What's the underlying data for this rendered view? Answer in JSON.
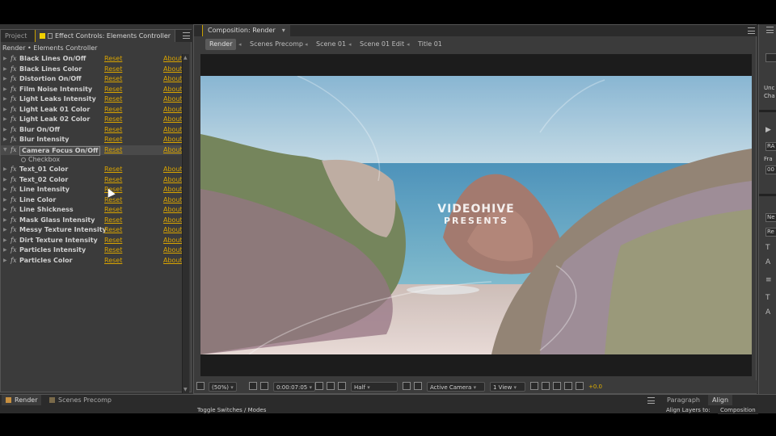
{
  "left_panel": {
    "tab_project": "Project",
    "tab_effect_controls": "Effect Controls: Elements Controller",
    "breadcrumb": "Render • Elements Controller",
    "reset_label": "Reset",
    "about_label": "About",
    "fx_label": "fx",
    "effects": [
      {
        "name": "Black Lines On/Off"
      },
      {
        "name": "Black Lines Color"
      },
      {
        "name": "Distortion On/Off"
      },
      {
        "name": "Film Noise Intensity"
      },
      {
        "name": "Light Leaks Intensity"
      },
      {
        "name": "Light Leak 01 Color"
      },
      {
        "name": "Light Leak 02 Color"
      },
      {
        "name": "Blur On/Off"
      },
      {
        "name": "Blur Intensity"
      },
      {
        "name": "Camera Focus On/Off",
        "expanded": true,
        "selected": true,
        "sub_label": "Checkbox"
      },
      {
        "name": "Text_01 Color"
      },
      {
        "name": "Text_02 Color"
      },
      {
        "name": "Line Intensity"
      },
      {
        "name": "Line Color"
      },
      {
        "name": "Line Shickness"
      },
      {
        "name": "Mask Glass Intensity"
      },
      {
        "name": "Messy Texture Intensity"
      },
      {
        "name": "Dirt Texture Intensity"
      },
      {
        "name": "Particles Intensity"
      },
      {
        "name": "Particles Color"
      }
    ]
  },
  "composition": {
    "tab_label": "Composition: Render",
    "flowchart": [
      "Render",
      "Scenes Precomp",
      "Scene 01",
      "Scene 01 Edit",
      "Title 01"
    ],
    "overlay_line1": "VIDEOHIVE",
    "overlay_line2": "PRESENTS",
    "viewer_bar": {
      "zoom": "(50%)",
      "timecode": "0:00:07:05",
      "resolution": "Half",
      "camera": "Active Camera",
      "views": "1 View",
      "exposure": "+0.0"
    }
  },
  "right_panel": {
    "text_a": "Unc",
    "text_b": "Cha",
    "box_a": "RA",
    "text_fra": "Fra",
    "box_b": "00",
    "box_c": "Ne",
    "box_d": "Re"
  },
  "bottom": {
    "tab_render": "Render",
    "tab_scenes_precomp": "Scenes Precomp",
    "toggle_label": "Toggle Switches / Modes",
    "tab_paragraph": "Paragraph",
    "tab_align": "Align",
    "align_layers_to": "Align Layers to:",
    "align_target": "Composition"
  },
  "colors": {
    "accent": "#d9a400",
    "panel_bg": "#3b3b3b",
    "active_tab_marker": "#f0d000"
  }
}
